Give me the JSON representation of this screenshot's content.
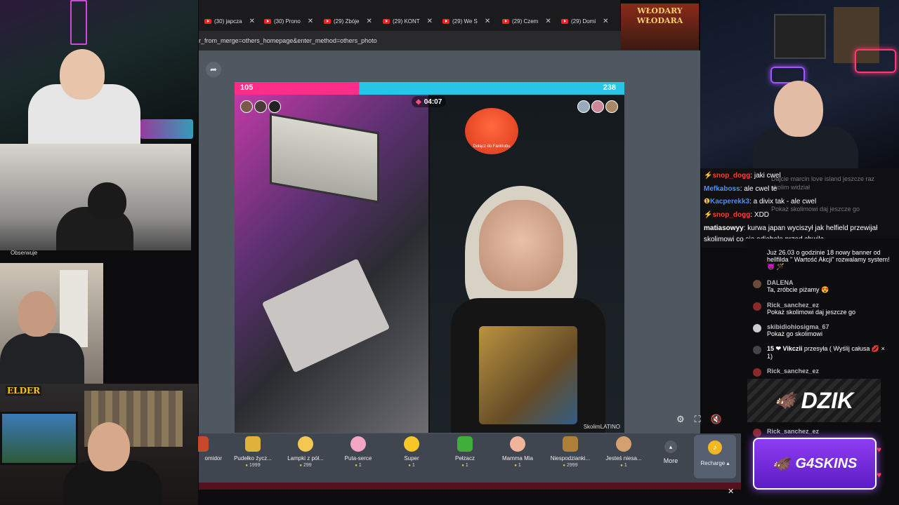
{
  "browser": {
    "tabs": [
      {
        "label": "(30) japcza"
      },
      {
        "label": "(30) Prono"
      },
      {
        "label": "(29) Zbóje"
      },
      {
        "label": "(29) KONT"
      },
      {
        "label": "(29) We S"
      },
      {
        "label": "(29) Czem"
      },
      {
        "label": "(29) Domi"
      }
    ],
    "url": "r_from_merge=others_homepage&enter_method=others_photo"
  },
  "live": {
    "score_left": "105",
    "score_right": "238",
    "timer": "04:07",
    "fanclub_text": "Dołącz do Fanklubu",
    "watermark": "SkolimLATINO"
  },
  "gifts": [
    {
      "name": "omidor",
      "price": ""
    },
    {
      "name": "Pudełko życz...",
      "price": "1999"
    },
    {
      "name": "Lampki z pół...",
      "price": "299"
    },
    {
      "name": "Puta-serce",
      "price": "1"
    },
    {
      "name": "Super",
      "price": "1"
    },
    {
      "name": "Pełzacz",
      "price": "1"
    },
    {
      "name": "Mamma Mia",
      "price": "1"
    },
    {
      "name": "Niespodzianki...",
      "price": "2999"
    },
    {
      "name": "Jesteś niesa...",
      "price": "1"
    }
  ],
  "gift_more": "More",
  "recharge": "Recharge",
  "overlay": {
    "obserwuje": "Obserwuje",
    "elder": "ELDER",
    "wlodary": "WŁODARY WŁODARA"
  },
  "chat_top": [
    {
      "user": "snop_dogg",
      "text": ": jaki cwel",
      "color": "#ff3b3b"
    },
    {
      "user": "Mefkaboss",
      "text": ": ale cwel te",
      "color": "#4d8dff"
    },
    {
      "user": "Kacperekk3",
      "text": ": a divix tak - ale cwel",
      "color": "#4d8dff"
    },
    {
      "user": "snop_dogg",
      "text": ": XDD",
      "color": "#ff3b3b"
    },
    {
      "user": "matiasowyy",
      "text": ": kurwa japan wyciszył jak helfield przewijał",
      "color": "#ffffff"
    },
    {
      "user": "",
      "text": "skolimowi co się odjebało przed chwilą",
      "color": "#ffffff"
    }
  ],
  "chat_top_ghost": [
    "Dajcie marcin love island jeszcze raz",
    "skolim widział",
    "Pokaż skolimowi daj jeszcze go"
  ],
  "chat_side": [
    {
      "name": "",
      "text": "Już 26.03 o godzinie 18 nowy banner od hellfilda \" Wartość Akcji\" rozwalamy system! 😈 🪄"
    },
    {
      "name": "DALENA",
      "text": "Ta, zróbcie piżamy 😍"
    },
    {
      "name": "Rick_sanchez_ez",
      "text": "Pokaż skolimowi daj jeszcze go"
    },
    {
      "name": "skibidiohiosigma_67",
      "text": "Pokaż go skolimowi"
    },
    {
      "name": "15 ❤ Vikczii",
      "text": "przesyła ( Wyślij całusa 💋 × 1)"
    },
    {
      "name": "Rick_sanchez_ez",
      "text": ""
    },
    {
      "name": "Rick_sanchez_ez",
      "text": ""
    }
  ],
  "sponsors": {
    "dzik": "DZIK",
    "g4skins": "G4SKINS"
  },
  "colors": {
    "pk_pink": "#ff2d8a",
    "pk_blue": "#28c6e6",
    "panel_bg": "#4f5761",
    "g4_purple": "#8f3cf2"
  }
}
